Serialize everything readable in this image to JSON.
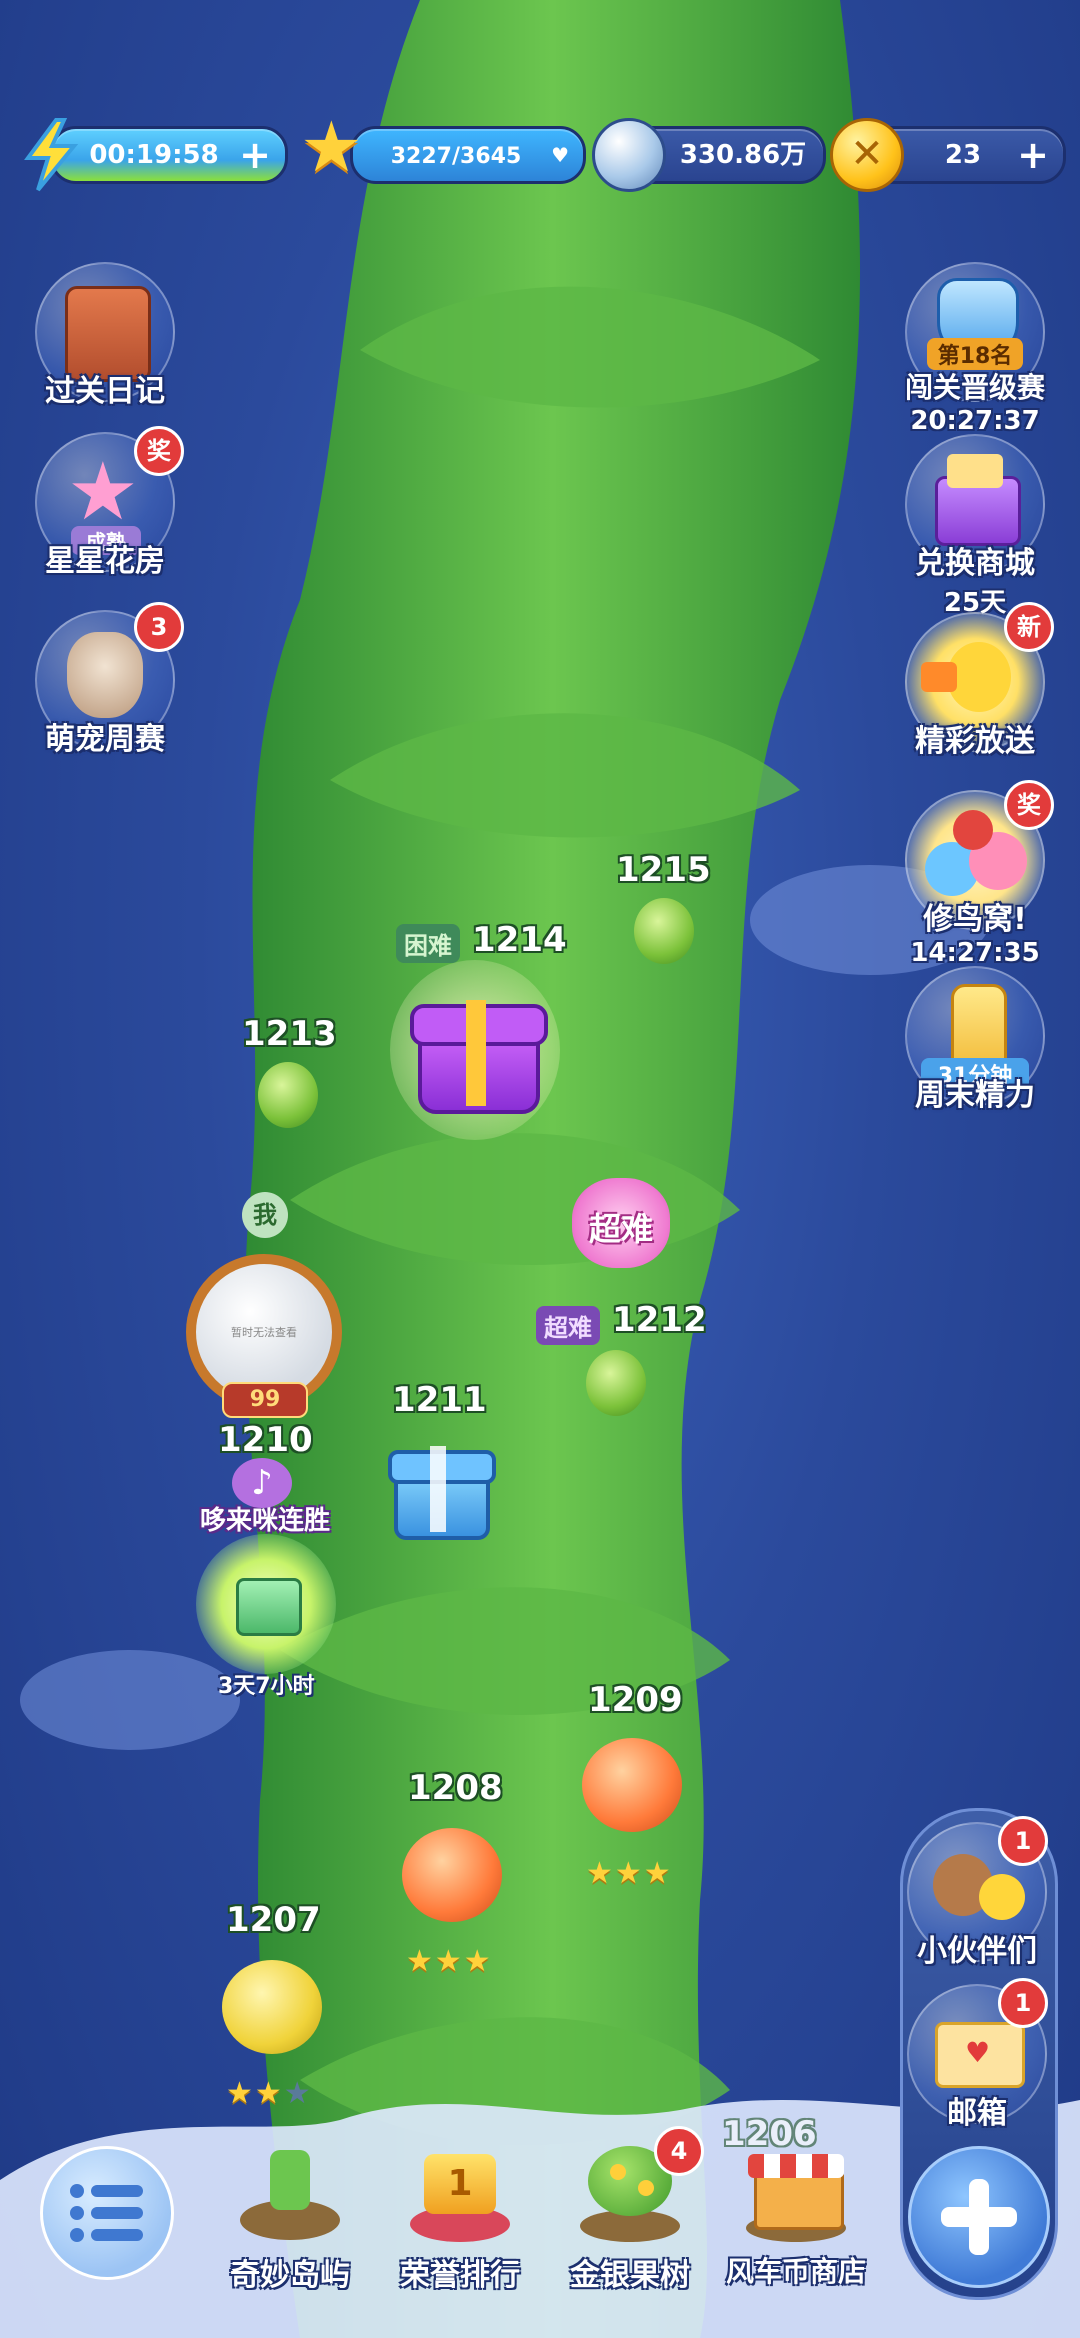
{
  "topbar": {
    "energy_timer": "00:19:58",
    "stars_progress": "3227/3645",
    "silver_amount": "330.86万",
    "coins": "23"
  },
  "left_buttons": [
    {
      "label": "过关日记",
      "inner": ""
    },
    {
      "label": "星星花房",
      "inner": "成熟",
      "badge": "奖"
    },
    {
      "label": "萌宠周赛",
      "badge": "3"
    }
  ],
  "right_buttons": [
    {
      "label": "闯关晋级赛",
      "inner": "第18名",
      "sub": "20:27:37"
    },
    {
      "label": "兑换商城",
      "sub": "25天"
    },
    {
      "label": "精彩放送",
      "badge": "新"
    },
    {
      "label": "修鸟窝!",
      "sub": "14:27:35",
      "badge": "奖"
    },
    {
      "label": "周末精力",
      "inner": "31分钟"
    }
  ],
  "levels": {
    "l1215": "1215",
    "l1214": "1214",
    "l1214_tag": "困难",
    "l1213": "1213",
    "l1212": "1212",
    "l1212_tag": "超难",
    "flower_text": "超难",
    "l1211": "1211",
    "l1210": "1210",
    "l1209": "1209",
    "l1208": "1208",
    "l1207": "1207",
    "l1206": "1206",
    "l1209_stars": 3,
    "l1208_stars": 3,
    "l1207_stars": 2
  },
  "player": {
    "me_label": "我",
    "avatar_text": "暂时无法查看",
    "level_badge": "99"
  },
  "event": {
    "title": "哆来咪连胜",
    "timer": "3天7小时"
  },
  "bottom_nav": [
    {
      "label": "奇妙岛屿"
    },
    {
      "label": "荣誉排行",
      "inner": "1"
    },
    {
      "label": "金银果树",
      "badge": "4"
    },
    {
      "label": "风车币商店"
    }
  ],
  "right_panel": [
    {
      "label": "小伙伴们",
      "badge": "1"
    },
    {
      "label": "邮箱",
      "badge": "1"
    }
  ],
  "icons": {
    "menu": "menu-icon",
    "plus": "plus-icon",
    "energy": "lightning-icon",
    "star": "star-icon",
    "silver": "leaf-coin-icon",
    "coin": "gold-coin-icon"
  },
  "colors": {
    "background": "#2b4a9c",
    "stalk": "#4fae3f",
    "badge": "#e23b3b",
    "gold": "#ffd23b"
  }
}
